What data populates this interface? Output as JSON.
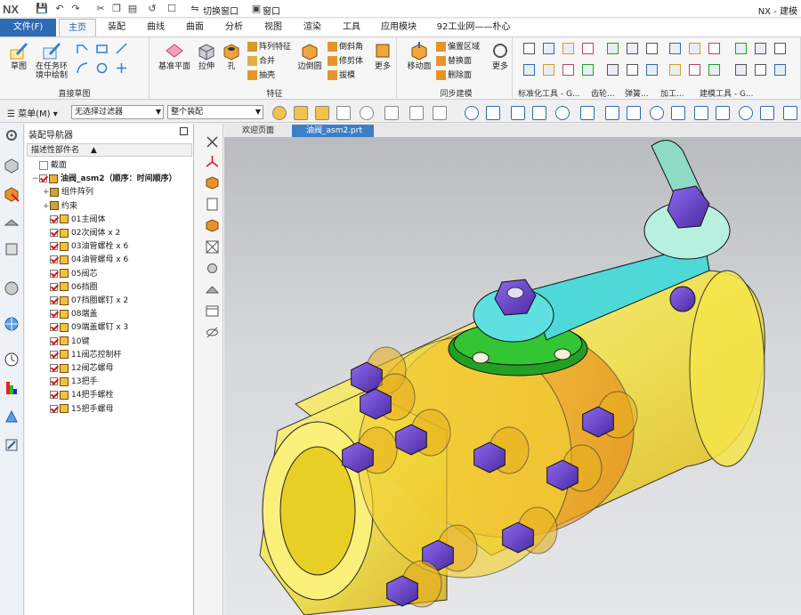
{
  "titlebar": {
    "logo": "NX",
    "switch_window": "切换窗口",
    "window": "窗口",
    "title": "NX - 建模"
  },
  "menubar": {
    "file": "文件(F)",
    "tabs": [
      "主页",
      "装配",
      "曲线",
      "曲面",
      "分析",
      "视图",
      "渲染",
      "工具",
      "应用模块",
      "92工业网——朴心"
    ]
  },
  "ribbon": {
    "direct_sketch": {
      "label": "直接草图",
      "sketch": "草图",
      "task_sketch": "在任务环境中绘制"
    },
    "feature": {
      "label": "特征",
      "datum_plane": "基准平面",
      "extrude": "拉伸",
      "hole": "孔",
      "pattern": "阵列特征",
      "unite": "合并",
      "shell": "抽壳",
      "edge_blend": "边倒圆",
      "chamfer": "倒斜角",
      "trim_body": "修剪体",
      "draft": "拔模",
      "more": "更多"
    },
    "sync": {
      "label": "同步建模",
      "move_face": "移动面",
      "offset_region": "偏置区域",
      "replace_face": "替换面",
      "delete_face": "删除面",
      "more": "更多"
    },
    "bottom_groups": [
      "标准化工具 - G...",
      "齿轮...",
      "弹簧...",
      "加工...",
      "建模工具 - G..."
    ]
  },
  "toolbar2": {
    "menu": "菜单(M)",
    "filter": "无选择过滤器",
    "scope": "整个装配"
  },
  "navigator": {
    "title": "装配导航器",
    "column": "描述性部件名",
    "items": [
      {
        "text": "截面",
        "level": 0,
        "type": "folder"
      },
      {
        "text": "油阀_asm2（顺序：时间顺序）",
        "level": 0,
        "type": "root"
      },
      {
        "text": "组件阵列",
        "level": 1,
        "type": "pattern"
      },
      {
        "text": "约束",
        "level": 1,
        "type": "constraint"
      },
      {
        "text": "01主阀体",
        "level": 1,
        "type": "part"
      },
      {
        "text": "02次阀体 x 2",
        "level": 1,
        "type": "part"
      },
      {
        "text": "03油管螺栓 x 6",
        "level": 1,
        "type": "part"
      },
      {
        "text": "04油管螺母 x 6",
        "level": 1,
        "type": "part"
      },
      {
        "text": "05阀芯",
        "level": 1,
        "type": "part"
      },
      {
        "text": "06挡圈",
        "level": 1,
        "type": "part"
      },
      {
        "text": "07挡圈螺钉 x 2",
        "level": 1,
        "type": "part"
      },
      {
        "text": "08端盖",
        "level": 1,
        "type": "part"
      },
      {
        "text": "09端盖螺钉 x 3",
        "level": 1,
        "type": "part"
      },
      {
        "text": "10键",
        "level": 1,
        "type": "part"
      },
      {
        "text": "11阀芯控制杆",
        "level": 1,
        "type": "part"
      },
      {
        "text": "12阀芯螺母",
        "level": 1,
        "type": "part"
      },
      {
        "text": "13把手",
        "level": 1,
        "type": "part"
      },
      {
        "text": "14把手螺栓",
        "level": 1,
        "type": "part"
      },
      {
        "text": "15把手螺母",
        "level": 1,
        "type": "part"
      }
    ]
  },
  "doc_tabs": [
    {
      "label": "欢迎页面",
      "active": false
    },
    {
      "label": "油阀_asm2.prt",
      "active": true
    }
  ],
  "colors": {
    "accent": "#2e6bb4",
    "valve_body": "#f2e600",
    "bolt": "#6b3fc2",
    "handle": "#5fe0d8",
    "ring": "#1f9e1f"
  }
}
